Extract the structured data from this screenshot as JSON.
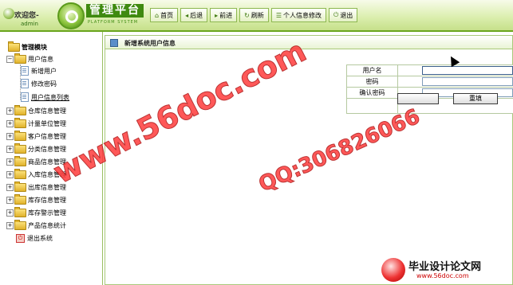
{
  "header": {
    "welcome": "欢迎您-",
    "username": "admin",
    "app_title": "管理平台",
    "app_subtitle": "PLATFORM SYSTEM",
    "nav": [
      {
        "icon": "home-icon",
        "label": "首页"
      },
      {
        "icon": "back-icon",
        "label": "后退"
      },
      {
        "icon": "forward-icon",
        "label": "前进"
      },
      {
        "icon": "refresh-icon",
        "label": "刷新"
      },
      {
        "icon": "user-edit-icon",
        "label": "个人信息修改"
      },
      {
        "icon": "power-icon",
        "label": "退出"
      }
    ]
  },
  "sidebar": {
    "title": "管理模块",
    "user_group": "用户信息",
    "user_children": [
      "新增用户",
      "修改密码",
      "用户信息列表"
    ],
    "groups": [
      "仓库信息管理",
      "计量单位管理",
      "客户信息管理",
      "分类信息管理",
      "商品信息管理",
      "入库信息管理",
      "出库信息管理",
      "库存信息管理",
      "库存警示管理",
      "产品信息统计"
    ],
    "exit": "退出系统"
  },
  "main": {
    "panel_title": "新增系统用户信息",
    "form": {
      "username_label": "用户名",
      "password_label": "密码",
      "confirm_label": "确认密码",
      "submit_label": "",
      "reset_label": "重填"
    }
  },
  "watermarks": {
    "site": "www.56doc.com",
    "qq": "QQ:306826066",
    "brand": "毕业设计论文网",
    "brand_url": "www.56doc.com"
  },
  "colors": {
    "accent": "#3f8a10",
    "watermark": "#ff3b3b"
  }
}
